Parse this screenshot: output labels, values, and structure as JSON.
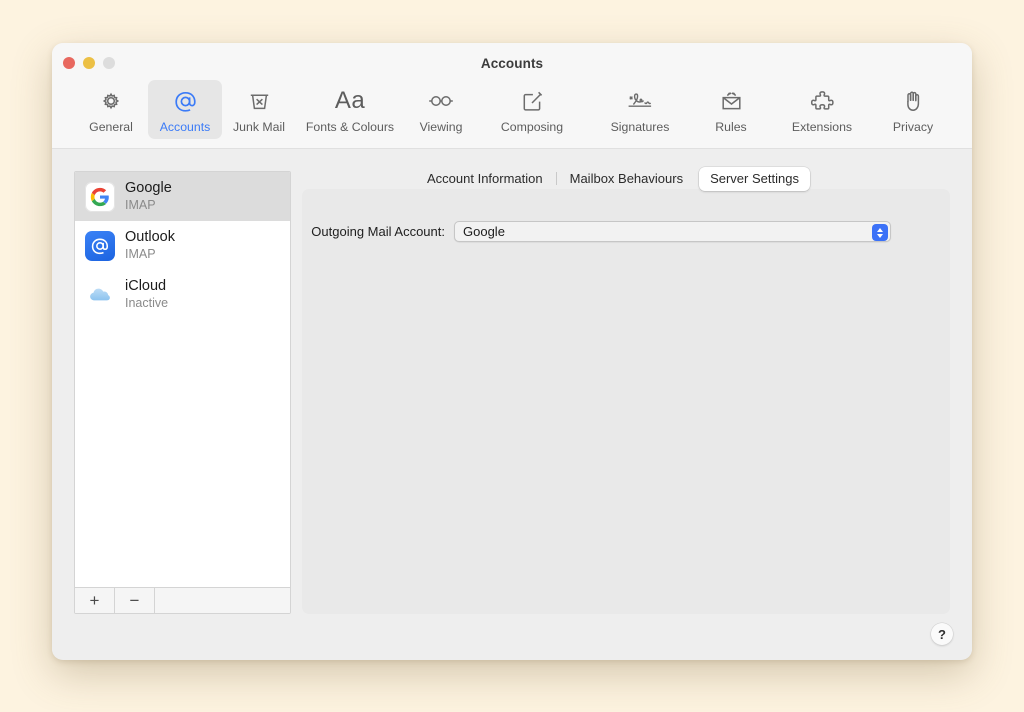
{
  "window": {
    "title": "Accounts",
    "traffic_lights": [
      {
        "name": "close",
        "color": "#e8685f"
      },
      {
        "name": "minimize",
        "color": "#ecc045"
      },
      {
        "name": "zoom",
        "color": "#dddddd"
      }
    ]
  },
  "toolbar": {
    "items": [
      {
        "label": "General",
        "icon": "gear-icon",
        "selected": false
      },
      {
        "label": "Accounts",
        "icon": "at-sign-icon",
        "selected": true
      },
      {
        "label": "Junk Mail",
        "icon": "trash-x-icon",
        "selected": false
      },
      {
        "label": "Fonts & Colours",
        "icon": "aa-text-icon",
        "selected": false
      },
      {
        "label": "Viewing",
        "icon": "glasses-icon",
        "selected": false
      },
      {
        "label": "Composing",
        "icon": "compose-pencil-icon",
        "selected": false
      },
      {
        "label": "Signatures",
        "icon": "signature-icon",
        "selected": false
      },
      {
        "label": "Rules",
        "icon": "envelope-arrows-icon",
        "selected": false
      },
      {
        "label": "Extensions",
        "icon": "puzzle-piece-icon",
        "selected": false
      },
      {
        "label": "Privacy",
        "icon": "hand-icon",
        "selected": false
      }
    ],
    "accent_color": "#3b7bf7"
  },
  "sidebar": {
    "accounts": [
      {
        "name": "Google",
        "status": "IMAP",
        "icon": "google-g-icon",
        "selected": true
      },
      {
        "name": "Outlook",
        "status": "IMAP",
        "icon": "outlook-at-icon",
        "selected": false
      },
      {
        "name": "iCloud",
        "status": "Inactive",
        "icon": "icloud-cloud-icon",
        "selected": false
      }
    ],
    "footer": {
      "add_label": "+",
      "remove_label": "−"
    }
  },
  "detail": {
    "tabs": [
      {
        "label": "Account Information",
        "selected": false
      },
      {
        "label": "Mailbox Behaviours",
        "selected": false
      },
      {
        "label": "Server Settings",
        "selected": true
      }
    ],
    "fields": [
      {
        "label": "Outgoing Mail Account:",
        "value": "Google",
        "control": "popup-button"
      }
    ]
  },
  "help": {
    "label": "?"
  }
}
